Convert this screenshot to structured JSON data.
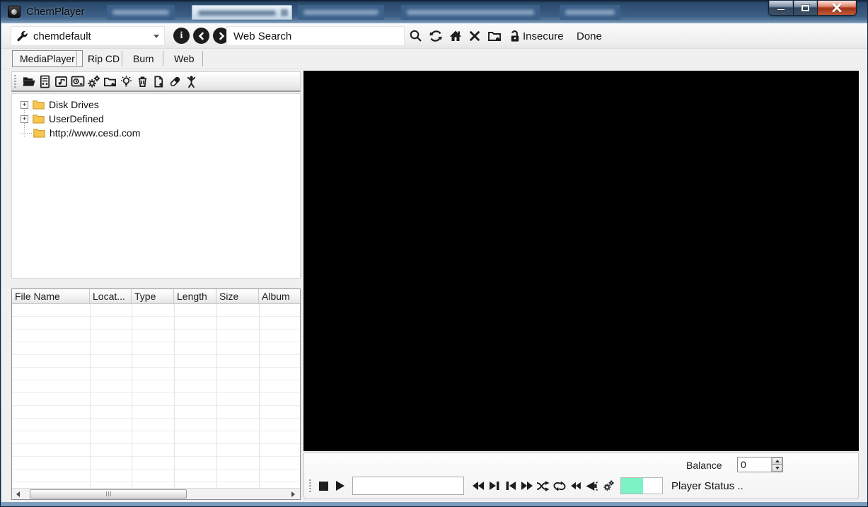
{
  "window": {
    "title": "ChemPlayer"
  },
  "titlebar": {
    "controls": [
      "minimize",
      "maximize",
      "close"
    ],
    "blurred_document_tabs": 5
  },
  "toolbar": {
    "profile": {
      "value": "chemdefault"
    },
    "web_search": {
      "value": "Web Search"
    },
    "insecure_label": "Insecure",
    "done_label": "Done",
    "icons": [
      "wrench",
      "info",
      "back",
      "forward",
      "search",
      "refresh",
      "home",
      "close",
      "add-folder",
      "unlock"
    ]
  },
  "tabs": [
    {
      "label": "MediaPlayer",
      "selected": true
    },
    {
      "label": "Rip CD",
      "selected": false
    },
    {
      "label": "Burn",
      "selected": false
    },
    {
      "label": "Web",
      "selected": false
    }
  ],
  "library_toolbar": {
    "icons": [
      "open-folder",
      "library",
      "media-file",
      "disk-drive",
      "settings-gears",
      "add-folder",
      "light-bulb",
      "delete-trash",
      "add-file",
      "eraser",
      "artist-person"
    ]
  },
  "tree": {
    "items": [
      {
        "label": "Disk Drives",
        "expandable": true
      },
      {
        "label": "UserDefined",
        "expandable": true
      },
      {
        "label": "http://www.cesd.com",
        "expandable": false
      }
    ]
  },
  "file_table": {
    "columns": [
      "File Name",
      "Locat...",
      "Type",
      "Length",
      "Size",
      "Album"
    ],
    "rows": []
  },
  "player": {
    "balance_label": "Balance",
    "balance_value": "0",
    "seek_value": "",
    "status_text": "Player Status ..",
    "progress_fill_color": "#7df2c4",
    "transport_icons": [
      "stop",
      "play",
      "rewind",
      "skip-end",
      "skip-start",
      "fast-forward",
      "shuffle",
      "repeat",
      "seek-back",
      "megaphone",
      "settings-gears"
    ]
  },
  "colors": {
    "titlebar_blue": "#3c5f86",
    "close_button_red": "#a03317",
    "progress_green": "#7df2c4"
  }
}
